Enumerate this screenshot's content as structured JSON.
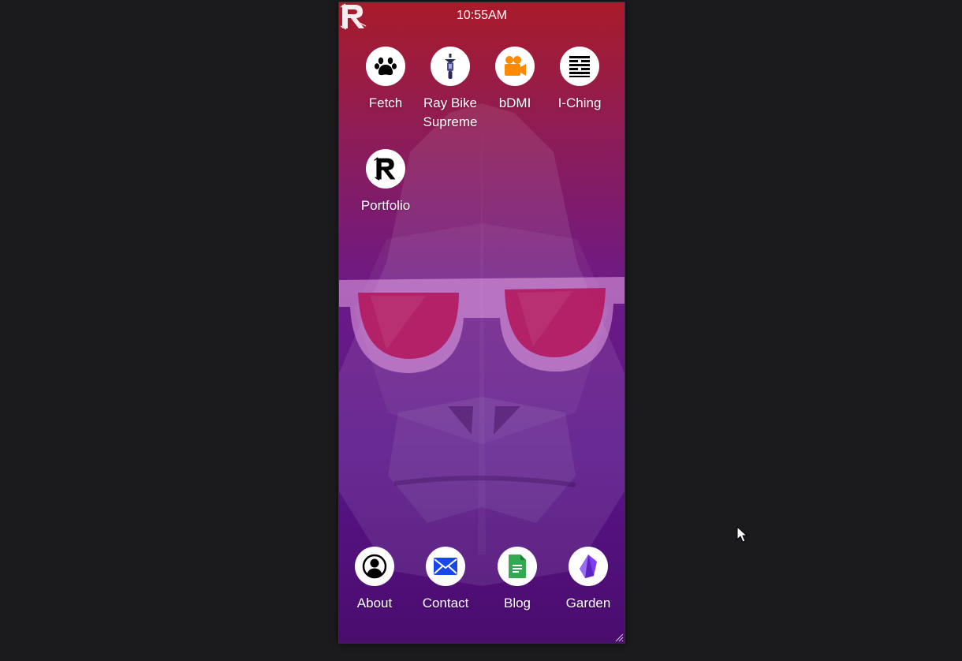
{
  "status_bar": {
    "time": "10:55AM",
    "logo_icon": "stylized-r-logo-icon"
  },
  "apps": [
    {
      "label": "Fetch",
      "icon": "paw-icon",
      "color": "#000000"
    },
    {
      "label": "Ray Bike Supreme",
      "icon": "bike-icon",
      "color": "#2a2a55"
    },
    {
      "label": "bDMI",
      "icon": "movie-camera-icon",
      "color": "#ff8a00"
    },
    {
      "label": "I-Ching",
      "icon": "hexagram-icon",
      "color": "#000000"
    },
    {
      "label": "Portfolio",
      "icon": "r-logo-icon",
      "color": "#000000"
    }
  ],
  "dock": [
    {
      "label": "About",
      "icon": "user-circle-icon",
      "color": "#000000"
    },
    {
      "label": "Contact",
      "icon": "envelope-icon",
      "color": "#1747e6"
    },
    {
      "label": "Blog",
      "icon": "document-icon",
      "color": "#34a853"
    },
    {
      "label": "Garden",
      "icon": "crystal-icon",
      "color": "#7d3cf0"
    }
  ],
  "colors": {
    "background": "#1b1b1d",
    "wallpaper_top": "#a81b2a",
    "wallpaper_bottom": "#4a0c6e"
  }
}
